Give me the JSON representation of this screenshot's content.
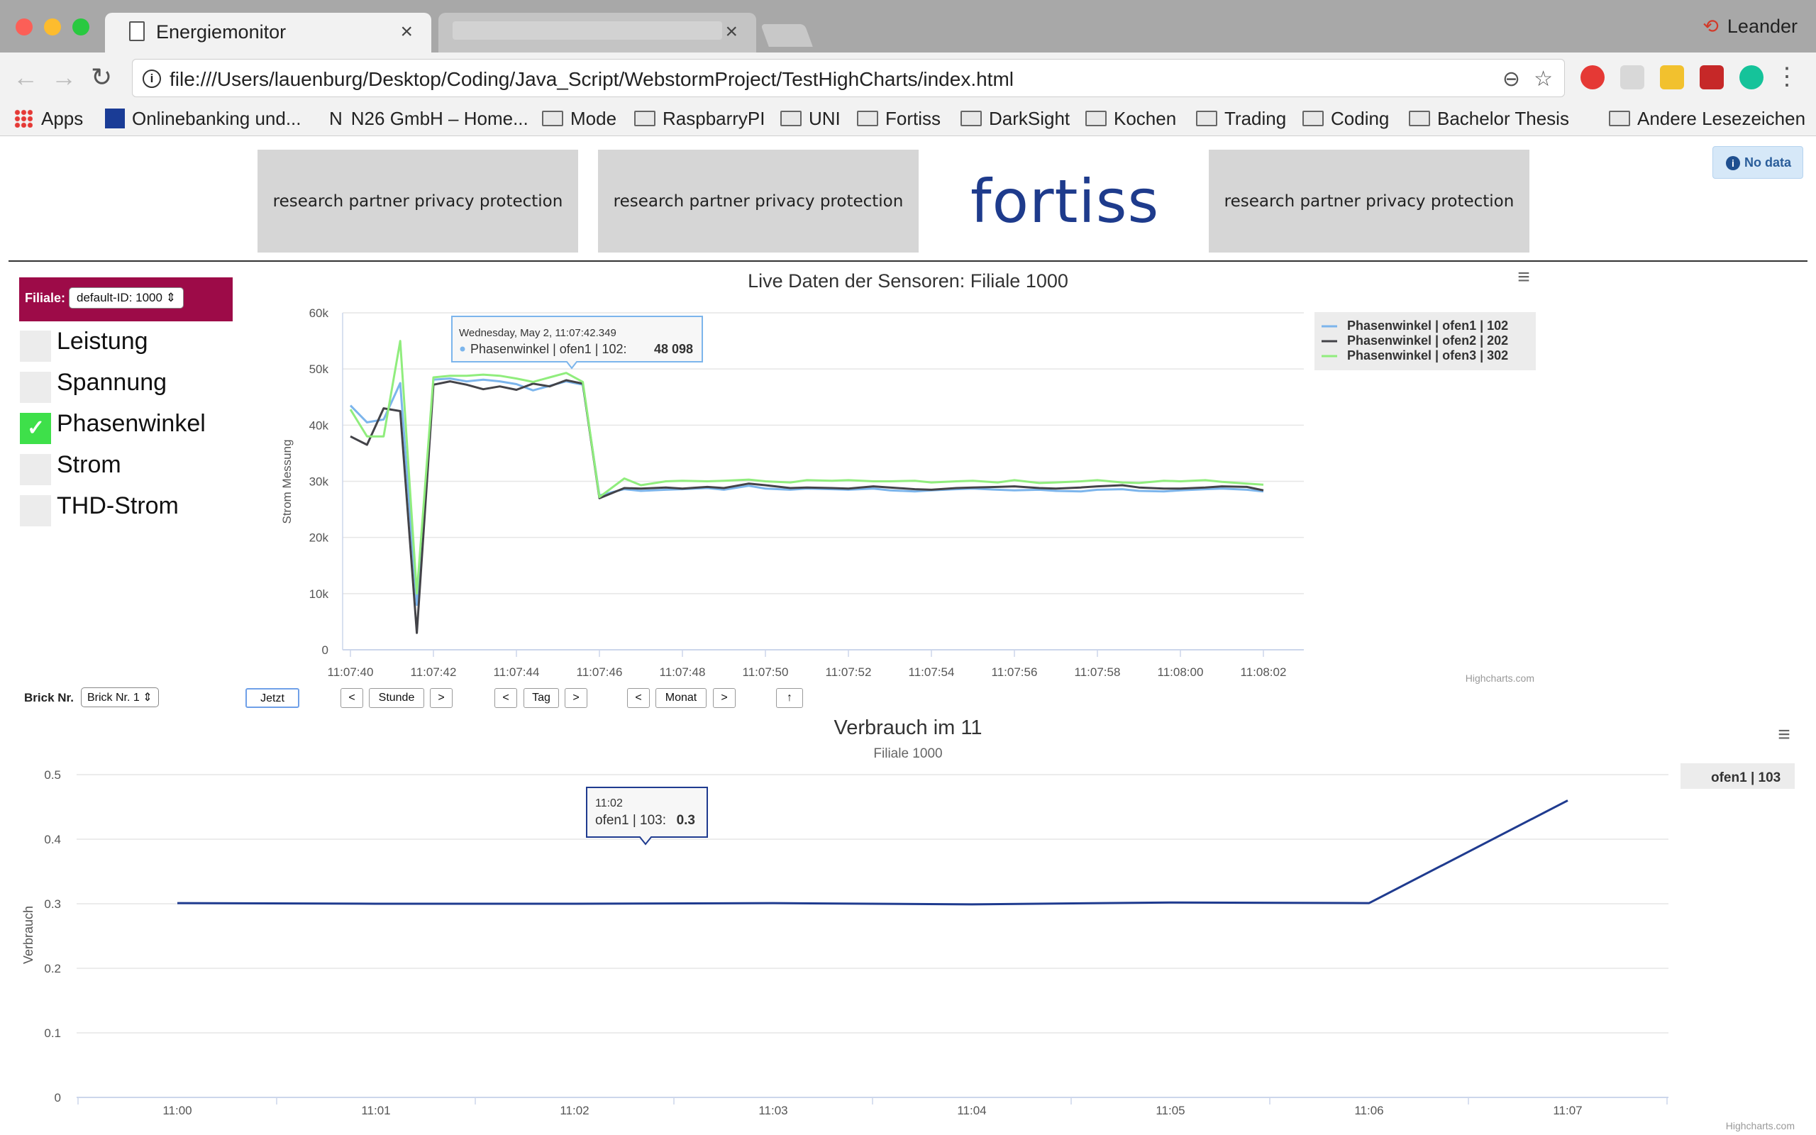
{
  "browser": {
    "tabs": [
      {
        "title": "Energiemonitor"
      },
      {
        "title": ""
      }
    ],
    "profile_name": "Leander",
    "url": "file:///Users/lauenburg/Desktop/Coding/Java_Script/WebstormProject/TestHighCharts/index.html",
    "bookmarks": [
      "Apps",
      "Onlinebanking und...",
      "N26 GmbH – Home...",
      "Mode",
      "RaspbarryPI",
      "UNI",
      "Fortiss",
      "DarkSight",
      "Kochen",
      "Trading",
      "Coding",
      "Bachelor Thesis"
    ],
    "other_bookmarks": "Andere Lesezeichen"
  },
  "header": {
    "partner_text": "research partner privacy protection",
    "logo_text": "fortiss",
    "nodata_label": "No data"
  },
  "sidebar": {
    "filiale_label": "Filiale:",
    "filiale_select": "default-ID: 1000",
    "measures": [
      {
        "label": "Leistung",
        "checked": false
      },
      {
        "label": "Spannung",
        "checked": false
      },
      {
        "label": "Phasenwinkel",
        "checked": true
      },
      {
        "label": "Strom",
        "checked": false
      },
      {
        "label": "THD-Strom",
        "checked": false
      }
    ]
  },
  "controls": {
    "brick_label": "Brick Nr.",
    "brick_select": "Brick Nr. 1",
    "now": "Jetzt",
    "prev": "<",
    "next": ">",
    "hour": "Stunde",
    "day": "Tag",
    "month": "Monat",
    "up": "↑"
  },
  "chart_data": [
    {
      "type": "line",
      "title": "Live Daten der Sensoren: Filiale 1000",
      "ylabel": "Strom Messung",
      "ylim": [
        0,
        60000
      ],
      "yticks": [
        "0",
        "10k",
        "20k",
        "30k",
        "40k",
        "50k",
        "60k"
      ],
      "xticks": [
        "11:07:40",
        "11:07:42",
        "11:07:44",
        "11:07:46",
        "11:07:48",
        "11:07:50",
        "11:07:52",
        "11:07:54",
        "11:07:56",
        "11:07:58",
        "11:08:00",
        "11:08:02"
      ],
      "x": [
        "11:07:40.0",
        "11:07:40.4",
        "11:07:40.8",
        "11:07:41.2",
        "11:07:41.6",
        "11:07:42.0",
        "11:07:42.4",
        "11:07:42.8",
        "11:07:43.2",
        "11:07:43.6",
        "11:07:44.0",
        "11:07:44.4",
        "11:07:44.8",
        "11:07:45.2",
        "11:07:45.6",
        "11:07:46.0",
        "11:07:46.6",
        "11:07:47.0",
        "11:07:47.6",
        "11:07:48.0",
        "11:07:48.6",
        "11:07:49.0",
        "11:07:49.6",
        "11:07:50.0",
        "11:07:50.6",
        "11:07:51.0",
        "11:07:51.6",
        "11:07:52.0",
        "11:07:52.6",
        "11:07:53.0",
        "11:07:53.6",
        "11:07:54.0",
        "11:07:54.6",
        "11:07:55.0",
        "11:07:55.6",
        "11:07:56.0",
        "11:07:56.6",
        "11:07:57.0",
        "11:07:57.6",
        "11:07:58.0",
        "11:07:58.6",
        "11:07:59.0",
        "11:07:59.6",
        "11:08:00.0",
        "11:08:00.6",
        "11:08:01.0",
        "11:08:01.6",
        "11:08:02.0"
      ],
      "series": [
        {
          "name": "Phasenwinkel | ofen1 | 102",
          "color": "#7cb5ec",
          "values": [
            43500,
            40500,
            41000,
            47500,
            8000,
            48098,
            48300,
            47800,
            48100,
            47800,
            47300,
            46200,
            47000,
            47800,
            47200,
            27500,
            28600,
            28300,
            28500,
            28600,
            28800,
            28500,
            29200,
            28700,
            28500,
            28700,
            28600,
            28500,
            28700,
            28400,
            28200,
            28400,
            28600,
            28700,
            28500,
            28400,
            28500,
            28300,
            28200,
            28500,
            28600,
            28300,
            28200,
            28400,
            28600,
            28700,
            28500,
            28200
          ]
        },
        {
          "name": "Phasenwinkel | ofen2 | 202",
          "color": "#434348",
          "values": [
            38000,
            36500,
            43000,
            42500,
            3000,
            47200,
            47800,
            47200,
            46400,
            46900,
            46300,
            47400,
            46900,
            48000,
            47400,
            27000,
            28800,
            28700,
            28900,
            28700,
            29000,
            28800,
            29600,
            29300,
            28800,
            28900,
            28800,
            28700,
            29100,
            28900,
            28600,
            28500,
            28800,
            28900,
            29000,
            29100,
            28800,
            28700,
            28900,
            29100,
            29300,
            28900,
            28700,
            28700,
            28900,
            29100,
            29000,
            28400
          ]
        },
        {
          "name": "Phasenwinkel | ofen3 | 302",
          "color": "#90ed7d",
          "values": [
            42800,
            38000,
            38000,
            55000,
            10000,
            48500,
            48800,
            48800,
            49000,
            48800,
            48300,
            47700,
            48500,
            49300,
            47700,
            27200,
            30500,
            29300,
            30000,
            30100,
            30000,
            30100,
            30300,
            30000,
            29800,
            30200,
            30100,
            30200,
            30000,
            30000,
            30100,
            29800,
            30000,
            30100,
            29800,
            30200,
            29700,
            29800,
            30000,
            30200,
            29800,
            29700,
            30100,
            30000,
            30200,
            29900,
            29600,
            29400
          ]
        }
      ],
      "legend_position": "right",
      "tooltip": {
        "header": "Wednesday, May 2, 11:07:42.349",
        "series": "Phasenwinkel | ofen1 | 102:",
        "value": "48 098"
      },
      "credits": "Highcharts.com"
    },
    {
      "type": "line",
      "title": "Verbrauch im 11",
      "subtitle": "Filiale 1000",
      "ylabel": "Verbrauch",
      "ylim": [
        0,
        0.5
      ],
      "yticks": [
        "0",
        "0.1",
        "0.2",
        "0.3",
        "0.4",
        "0.5"
      ],
      "categories": [
        "11:00",
        "11:01",
        "11:02",
        "11:03",
        "11:04",
        "11:05",
        "11:06",
        "11:07"
      ],
      "series": [
        {
          "name": "ofen1 | 103",
          "color": "#1f3b8f",
          "values": [
            0.301,
            0.3,
            0.3,
            0.301,
            0.299,
            0.302,
            0.301,
            0.46
          ]
        }
      ],
      "legend_position": "right",
      "tooltip": {
        "header": "11:02",
        "series": "ofen1 | 103:",
        "value": "0.3"
      },
      "credits": "Highcharts.com"
    }
  ]
}
